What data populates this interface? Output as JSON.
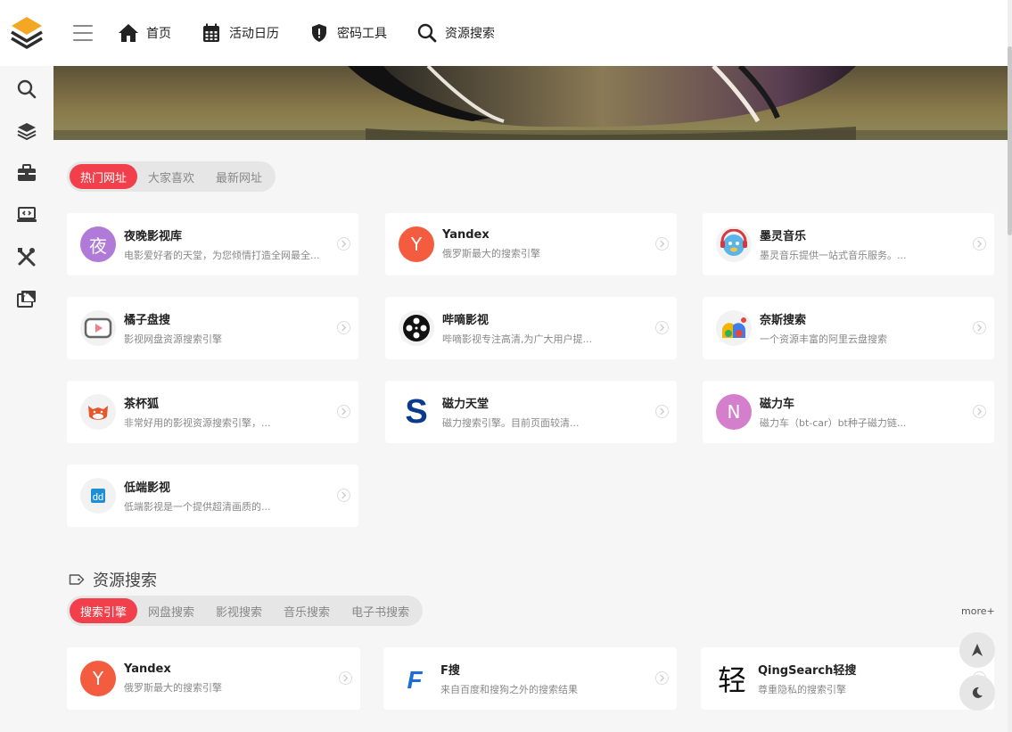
{
  "header": {
    "nav": [
      {
        "label": "首页",
        "icon": "home-icon"
      },
      {
        "label": "活动日历",
        "icon": "calendar-icon"
      },
      {
        "label": "密码工具",
        "icon": "shield-icon"
      },
      {
        "label": "资源搜索",
        "icon": "search-icon"
      }
    ]
  },
  "sidebar": {
    "icons": [
      "search-icon",
      "layers-icon",
      "toolbox-icon",
      "laptop-code-icon",
      "tools-icon",
      "photo-gallery-icon"
    ]
  },
  "hot_tabs": [
    {
      "label": "热门网址",
      "active": true
    },
    {
      "label": "大家喜欢",
      "active": false
    },
    {
      "label": "最新网址",
      "active": false
    }
  ],
  "hot_sites": [
    {
      "name": "夜晚影视库",
      "desc": "电影爱好者的天堂，为您倾情打造全网最全...",
      "avatar_text": "夜",
      "avatar_color": "#b07ad8"
    },
    {
      "name": "Yandex",
      "desc": "俄罗斯最大的搜索引擎",
      "avatar_text": "Y",
      "avatar_color": "#f35c3e"
    },
    {
      "name": "墨灵音乐",
      "desc": "墨灵音乐提供一站式音乐服务。...",
      "avatar_text": "",
      "avatar_color": "#f2f2f2"
    },
    {
      "name": "橘子盘搜",
      "desc": "影视网盘资源搜索引擎",
      "avatar_text": "",
      "avatar_color": "#f2f2f2"
    },
    {
      "name": "哔嘀影视",
      "desc": "哔嘀影视专注高清,为广大用户提...",
      "avatar_text": "",
      "avatar_color": "#f2f2f2"
    },
    {
      "name": "奈斯搜索",
      "desc": "一个资源丰富的阿里云盘搜索",
      "avatar_text": "",
      "avatar_color": "#f2f2f2"
    },
    {
      "name": "茶杯狐",
      "desc": "非常好用的影视资源搜索引擎，...",
      "avatar_text": "",
      "avatar_color": "#f2f2f2"
    },
    {
      "name": "磁力天堂",
      "desc": "磁力搜索引擎。目前页面较清...",
      "avatar_text": "S",
      "avatar_color": "#ffffff"
    },
    {
      "name": "磁力车",
      "desc": "磁力车（bt-car）bt种子磁力链...",
      "avatar_text": "N",
      "avatar_color": "#d47fcb"
    },
    {
      "name": "低端影视",
      "desc": "低端影视是一个提供超清画质的...",
      "avatar_text": "dd",
      "avatar_color": "#f2f2f2"
    }
  ],
  "section": {
    "title": "资源搜索",
    "more": "more+"
  },
  "search_tabs": [
    {
      "label": "搜索引擎",
      "active": true
    },
    {
      "label": "网盘搜索",
      "active": false
    },
    {
      "label": "影视搜索",
      "active": false
    },
    {
      "label": "音乐搜索",
      "active": false
    },
    {
      "label": "电子书搜索",
      "active": false
    }
  ],
  "search_sites": [
    {
      "name": "Yandex",
      "desc": "俄罗斯最大的搜索引擎",
      "avatar_text": "Y",
      "avatar_color": "#f35c3e"
    },
    {
      "name": "F搜",
      "desc": "来自百度和搜狗之外的搜索结果",
      "avatar_text": "F",
      "avatar_color": "#ffffff"
    },
    {
      "name": "QingSearch轻搜",
      "desc": "尊重隐私的搜索引擎",
      "avatar_text": "轻",
      "avatar_color": "#ffffff"
    }
  ],
  "colors": {
    "accent": "#f1404b",
    "logo_orange": "#f5a623",
    "logo_dark": "#2c2c2c"
  }
}
